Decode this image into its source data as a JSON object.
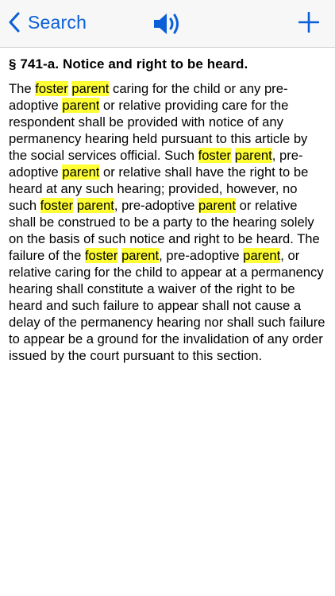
{
  "navbar": {
    "back_label": "Search",
    "back_icon": "chevron-left-icon",
    "speaker_icon": "speaker-icon",
    "add_icon": "plus-icon",
    "accent_color": "#0a5fd8"
  },
  "section": {
    "heading": "§ 741-a. Notice and right to be heard.",
    "highlight_color": "#ffff33",
    "segments": [
      {
        "t": "The ",
        "h": false
      },
      {
        "t": "foster",
        "h": true
      },
      {
        "t": " ",
        "h": false
      },
      {
        "t": "parent",
        "h": true
      },
      {
        "t": " caring for the child or any pre-adoptive ",
        "h": false
      },
      {
        "t": "parent",
        "h": true
      },
      {
        "t": " or relative providing care for the respondent shall be provided with notice of any permanency hearing held pursuant to this article by the social services official. Such ",
        "h": false
      },
      {
        "t": "foster",
        "h": true
      },
      {
        "t": " ",
        "h": false
      },
      {
        "t": "parent",
        "h": true
      },
      {
        "t": ", pre-adoptive ",
        "h": false
      },
      {
        "t": "parent",
        "h": true
      },
      {
        "t": " or relative shall have the right to be heard at any such hearing; provided, however, no such ",
        "h": false
      },
      {
        "t": "foster",
        "h": true
      },
      {
        "t": " ",
        "h": false
      },
      {
        "t": "parent",
        "h": true
      },
      {
        "t": ", pre-adoptive ",
        "h": false
      },
      {
        "t": "parent",
        "h": true
      },
      {
        "t": " or relative shall be construed to be a party to the hearing solely on the basis of such notice and right to be heard. The failure of the ",
        "h": false
      },
      {
        "t": "foster",
        "h": true
      },
      {
        "t": " ",
        "h": false
      },
      {
        "t": "parent",
        "h": true
      },
      {
        "t": ", pre-adoptive ",
        "h": false
      },
      {
        "t": "parent",
        "h": true
      },
      {
        "t": ", or relative caring for the child to appear at a permanency hearing shall constitute a waiver of the right to be heard and such failure to appear shall not cause a delay of the permanency hearing nor shall such failure to appear be a ground for the invalidation of any order issued by the court pursuant to this section.",
        "h": false
      }
    ]
  }
}
